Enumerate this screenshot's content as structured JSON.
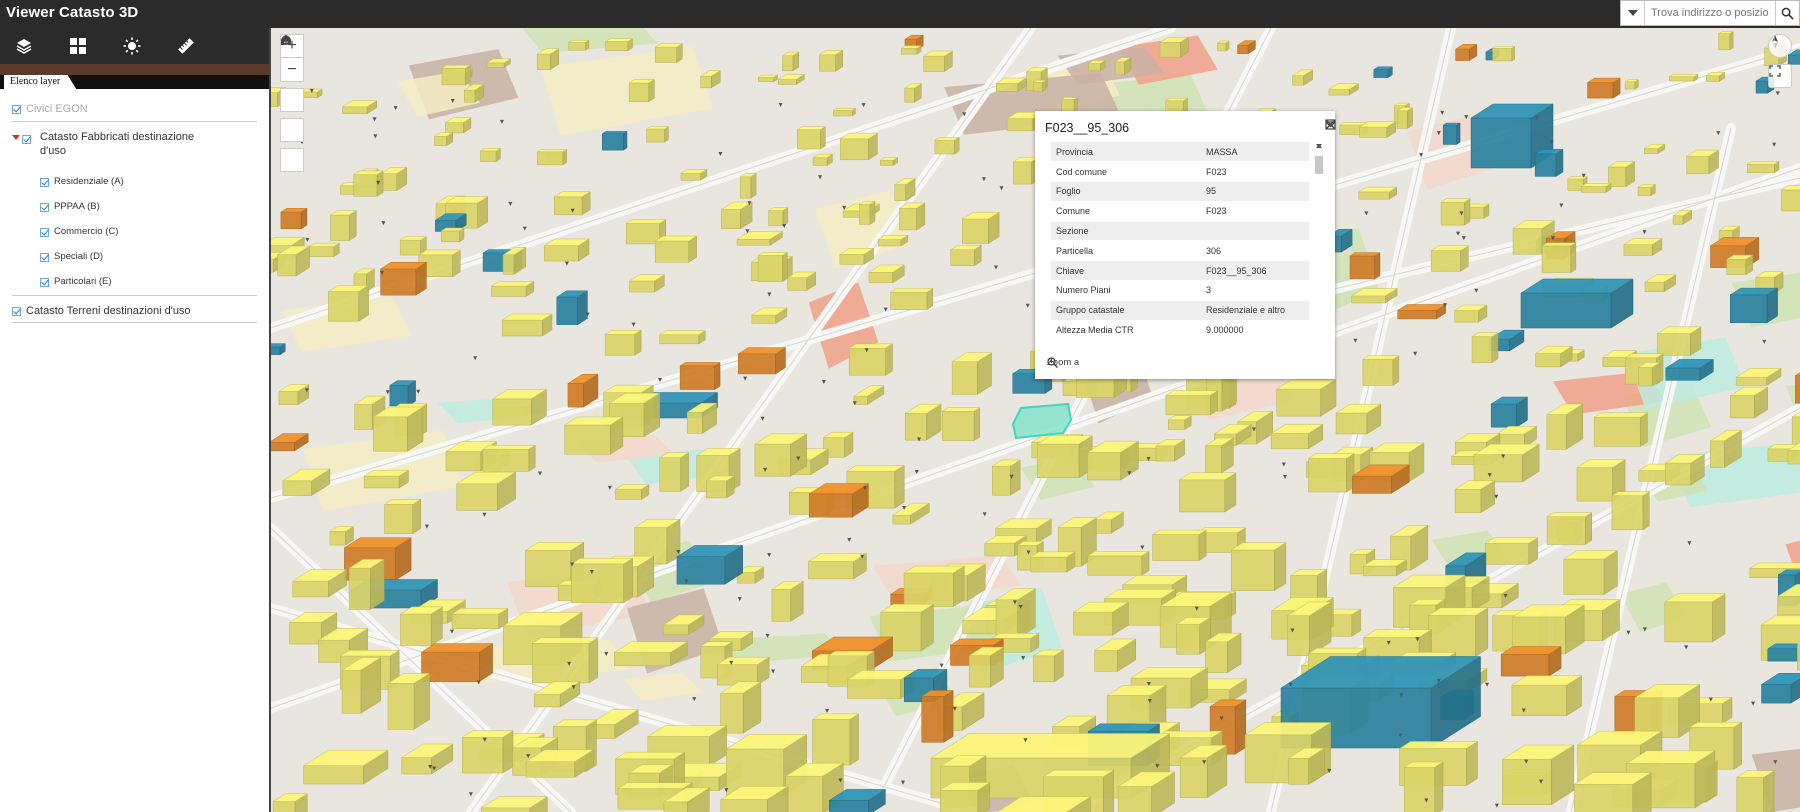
{
  "app": {
    "title": "Viewer Catasto 3D"
  },
  "search": {
    "placeholder": "Trova indirizzo o posizion"
  },
  "panel": {
    "tab": "Elenco layer",
    "layers": [
      {
        "label": "Civici EGON"
      },
      {
        "label_line1": "Catasto Fabbricati destinazione",
        "label_line2": "d'uso"
      },
      {
        "label": "Catasto Terreni destinazioni d'uso"
      }
    ],
    "sublayers": [
      "Residenziale (A)",
      "PPPAA (B)",
      "Commercio (C)",
      "Speciali (D)",
      "Particolari (E)"
    ]
  },
  "map_controls": {
    "zoom_in": "+",
    "zoom_out": "−"
  },
  "popup": {
    "title": "F023__95_306",
    "rows": [
      {
        "k": "Provincia",
        "v": "MASSA"
      },
      {
        "k": "Cod comune",
        "v": "F023"
      },
      {
        "k": "Foglio",
        "v": "95"
      },
      {
        "k": "Comune",
        "v": "F023"
      },
      {
        "k": "Sezione",
        "v": ""
      },
      {
        "k": "Particella",
        "v": "306"
      },
      {
        "k": "Chiave",
        "v": "F023__95_306"
      },
      {
        "k": "Numero Piani",
        "v": "3"
      },
      {
        "k": "Gruppo catastale",
        "v": "Residenziale e altro"
      },
      {
        "k": "Altezza Media CTR",
        "v": "9.000000"
      }
    ],
    "zoom_label": "Zoom a"
  },
  "colors": {
    "residential": "#f2ec74",
    "special": "#2f8fb0",
    "commercial": "#e58a2a",
    "selected": "#7fe3c8",
    "ground": "#e8e6df",
    "road": "#f7f7f5"
  }
}
